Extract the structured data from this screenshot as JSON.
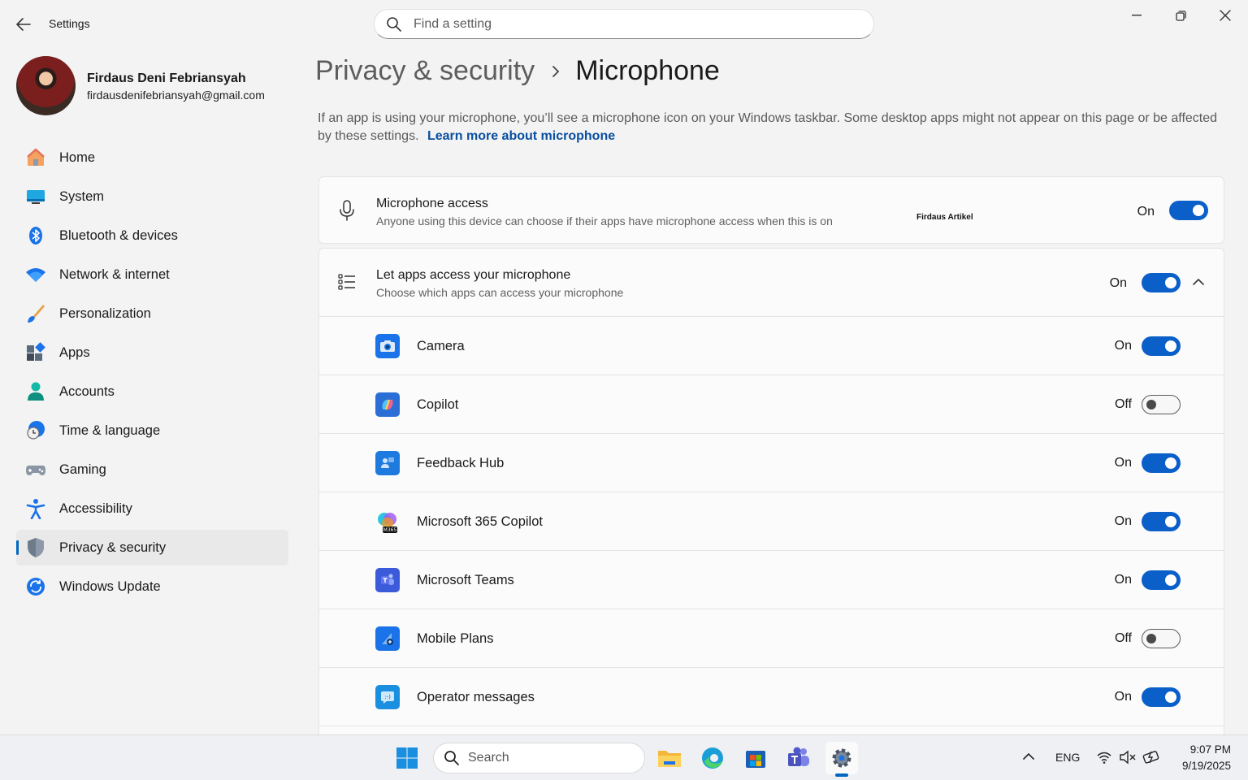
{
  "window": {
    "app_title": "Settings",
    "search_placeholder": "Find a setting"
  },
  "profile": {
    "name": "Firdaus Deni Febriansyah",
    "email": "firdausdenifebriansyah@gmail.com"
  },
  "sidebar": {
    "items": [
      {
        "label": "Home",
        "icon": "home-icon"
      },
      {
        "label": "System",
        "icon": "system-icon"
      },
      {
        "label": "Bluetooth & devices",
        "icon": "bluetooth-icon"
      },
      {
        "label": "Network & internet",
        "icon": "wifi-icon"
      },
      {
        "label": "Personalization",
        "icon": "brush-icon"
      },
      {
        "label": "Apps",
        "icon": "apps-icon"
      },
      {
        "label": "Accounts",
        "icon": "accounts-icon"
      },
      {
        "label": "Time & language",
        "icon": "clock-globe-icon"
      },
      {
        "label": "Gaming",
        "icon": "gamepad-icon"
      },
      {
        "label": "Accessibility",
        "icon": "accessibility-icon"
      },
      {
        "label": "Privacy & security",
        "icon": "shield-icon",
        "active": true
      },
      {
        "label": "Windows Update",
        "icon": "update-icon"
      }
    ]
  },
  "main": {
    "breadcrumb_parent": "Privacy & security",
    "breadcrumb_current": "Microphone",
    "description": "If an app is using your microphone, you’ll see a microphone icon on your Windows taskbar. Some desktop apps might not appear on this page or be affected by these settings.",
    "learn_more": "Learn more about microphone",
    "mic_access": {
      "title": "Microphone access",
      "subtitle": "Anyone using this device can choose if their apps have microphone access when this is on",
      "state": "On"
    },
    "watermark": "Firdaus Artikel",
    "let_apps": {
      "title": "Let apps access your microphone",
      "subtitle": "Choose which apps can access your microphone",
      "state": "On"
    },
    "apps": [
      {
        "name": "Camera",
        "state": "On",
        "icon": "camera-icon",
        "color": "#1a73e8"
      },
      {
        "name": "Copilot",
        "state": "Off",
        "icon": "copilot-icon",
        "color": "#2b6fd6"
      },
      {
        "name": "Feedback Hub",
        "state": "On",
        "icon": "feedback-hub-icon",
        "color": "#1f7ae0"
      },
      {
        "name": "Microsoft 365 Copilot",
        "state": "On",
        "icon": "m365-copilot-icon",
        "color": "#7b5cf0"
      },
      {
        "name": "Microsoft Teams",
        "state": "On",
        "icon": "teams-icon",
        "color": "#3b5bdb"
      },
      {
        "name": "Mobile Plans",
        "state": "Off",
        "icon": "mobile-plans-icon",
        "color": "#1a73e8"
      },
      {
        "name": "Operator messages",
        "state": "On",
        "icon": "operator-messages-icon",
        "color": "#1a8fe0"
      }
    ]
  },
  "taskbar": {
    "search_label": "Search",
    "language": "ENG",
    "time": "9:07 PM",
    "date": "9/19/2025"
  },
  "colors": {
    "accent": "#0a5fc9",
    "link": "#0a4fa0"
  }
}
